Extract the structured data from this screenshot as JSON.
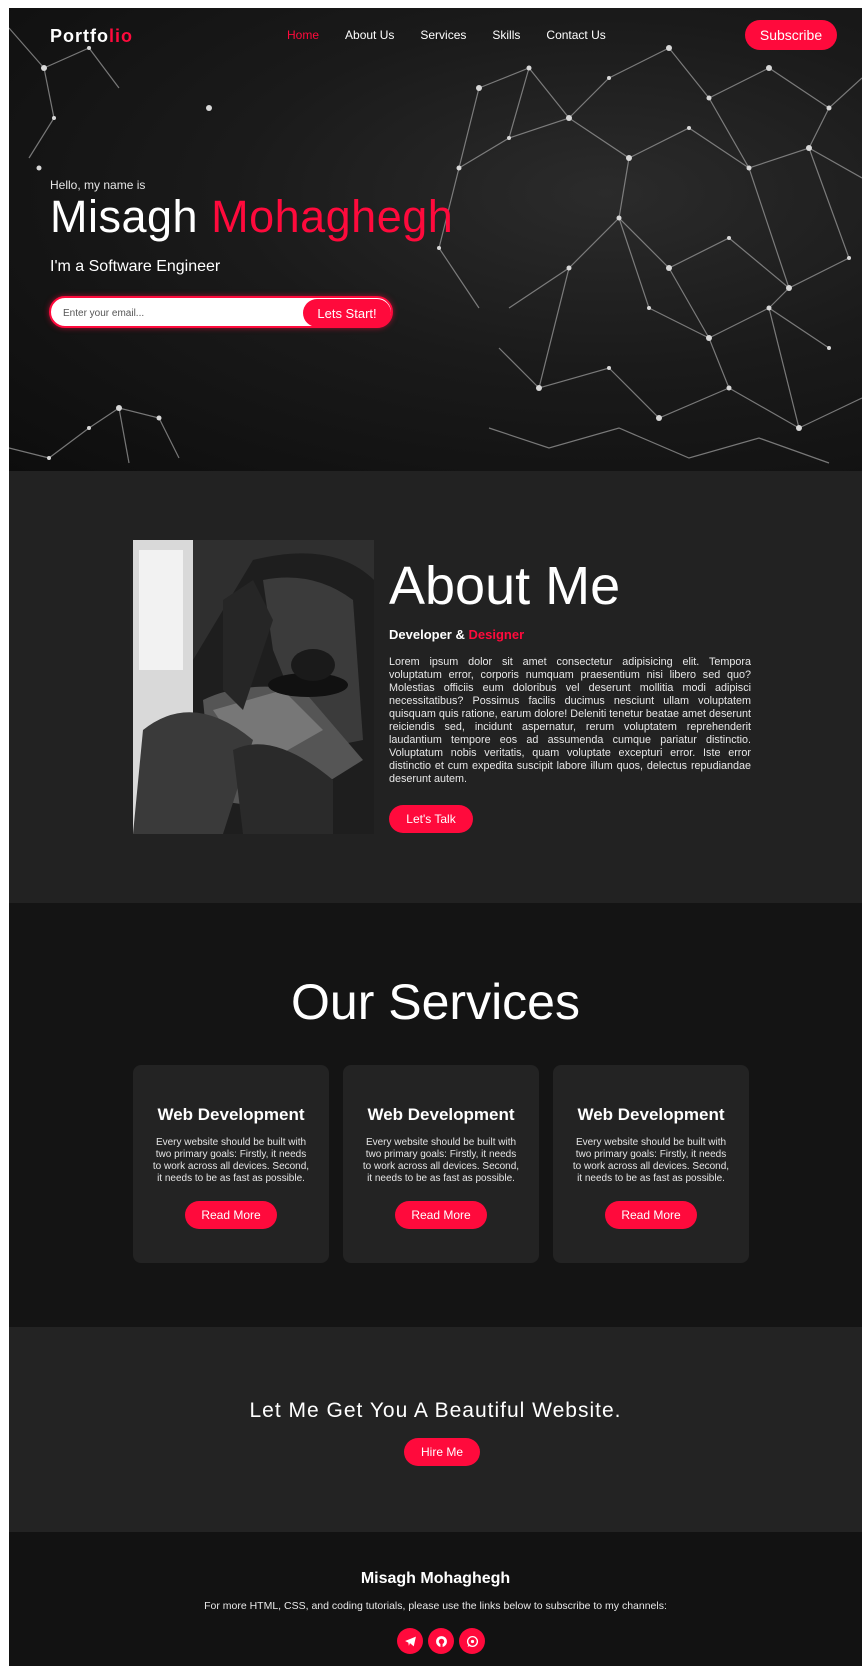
{
  "header": {
    "brand_prefix": "Portfo",
    "brand_accent": "lio",
    "nav": [
      {
        "label": "Home",
        "active": true
      },
      {
        "label": "About Us"
      },
      {
        "label": "Services"
      },
      {
        "label": "Skills"
      },
      {
        "label": "Contact Us"
      }
    ],
    "subscribe_label": "Subscribe"
  },
  "hero": {
    "greeting": "Hello, my name is",
    "first_name": "Misagh",
    "last_name": "Mohaghegh",
    "role": "I'm a Software Engineer",
    "email_placeholder": "Enter your email...",
    "cta_label": "Lets Start!"
  },
  "about": {
    "title": "About Me",
    "subtitle_prefix": "Developer &",
    "subtitle_accent": "Designer",
    "body": "Lorem ipsum dolor sit amet consectetur adipisicing elit. Tempora voluptatum error, corporis numquam praesentium nisi libero sed quo? Molestias officiis eum doloribus vel deserunt mollitia modi adipisci necessitatibus? Possimus facilis ducimus nesciunt ullam voluptatem quisquam quis ratione, earum dolore! Deleniti tenetur beatae amet deserunt reiciendis sed, incidunt aspernatur, rerum voluptatem reprehenderit laudantium tempore eos ad assumenda cumque pariatur distinctio. Voluptatum nobis veritatis, quam voluptate excepturi error. Iste error distinctio et cum expedita suscipit labore illum quos, delectus repudiandae deserunt autem.",
    "button_label": "Let's Talk"
  },
  "services": {
    "title": "Our Services",
    "cards": [
      {
        "title": "Web Development",
        "text": "Every website should be built with two primary goals: Firstly, it needs to work across all devices. Second, it needs to be as fast as possible.",
        "button": "Read More"
      },
      {
        "title": "Web Development",
        "text": "Every website should be built with two primary goals: Firstly, it needs to work across all devices. Second, it needs to be as fast as possible.",
        "button": "Read More"
      },
      {
        "title": "Web Development",
        "text": "Every website should be built with two primary goals: Firstly, it needs to work across all devices. Second, it needs to be as fast as possible.",
        "button": "Read More"
      }
    ]
  },
  "cta": {
    "title": "Let Me Get You A Beautiful Website.",
    "button_label": "Hire Me"
  },
  "footer": {
    "name": "Misagh Mohaghegh",
    "text": "For more HTML, CSS, and coding tutorials, please use the links below to subscribe to my channels:",
    "socials": [
      "telegram-icon",
      "github-icon",
      "whatsapp-icon"
    ]
  },
  "colors": {
    "accent": "#ff0a3c",
    "dark": "#141414",
    "panel": "#232323"
  }
}
